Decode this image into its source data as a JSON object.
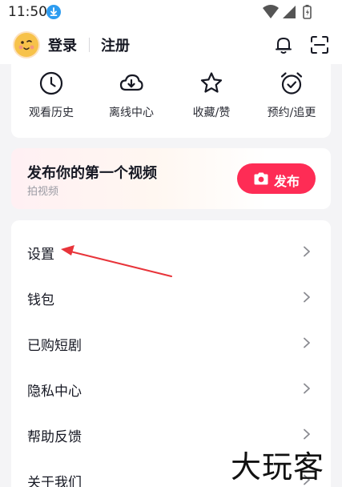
{
  "status_bar": {
    "time": "11:50",
    "icons": [
      "download-badge-icon",
      "wifi-icon",
      "cellular-icon",
      "battery-icon"
    ]
  },
  "header": {
    "login_label": "登录",
    "register_label": "注册",
    "icons": [
      "avatar",
      "bell-icon",
      "scan-icon"
    ]
  },
  "quick_tiles": [
    {
      "label": "观看历史",
      "icon": "clock-icon"
    },
    {
      "label": "离线中心",
      "icon": "cloud-download-icon"
    },
    {
      "label": "收藏/赞",
      "icon": "star-icon"
    },
    {
      "label": "预约/追更",
      "icon": "alarm-clock-icon"
    }
  ],
  "publish_card": {
    "title": "发布你的第一个视频",
    "subtitle": "拍视频",
    "button_label": "发布",
    "button_color": "#fe2c55"
  },
  "menu": [
    {
      "label": "设置"
    },
    {
      "label": "钱包"
    },
    {
      "label": "已购短剧"
    },
    {
      "label": "隐私中心"
    },
    {
      "label": "帮助反馈"
    },
    {
      "label": "关于我们"
    }
  ],
  "annotation": {
    "color": "#e8343a"
  },
  "watermark": "大玩客"
}
